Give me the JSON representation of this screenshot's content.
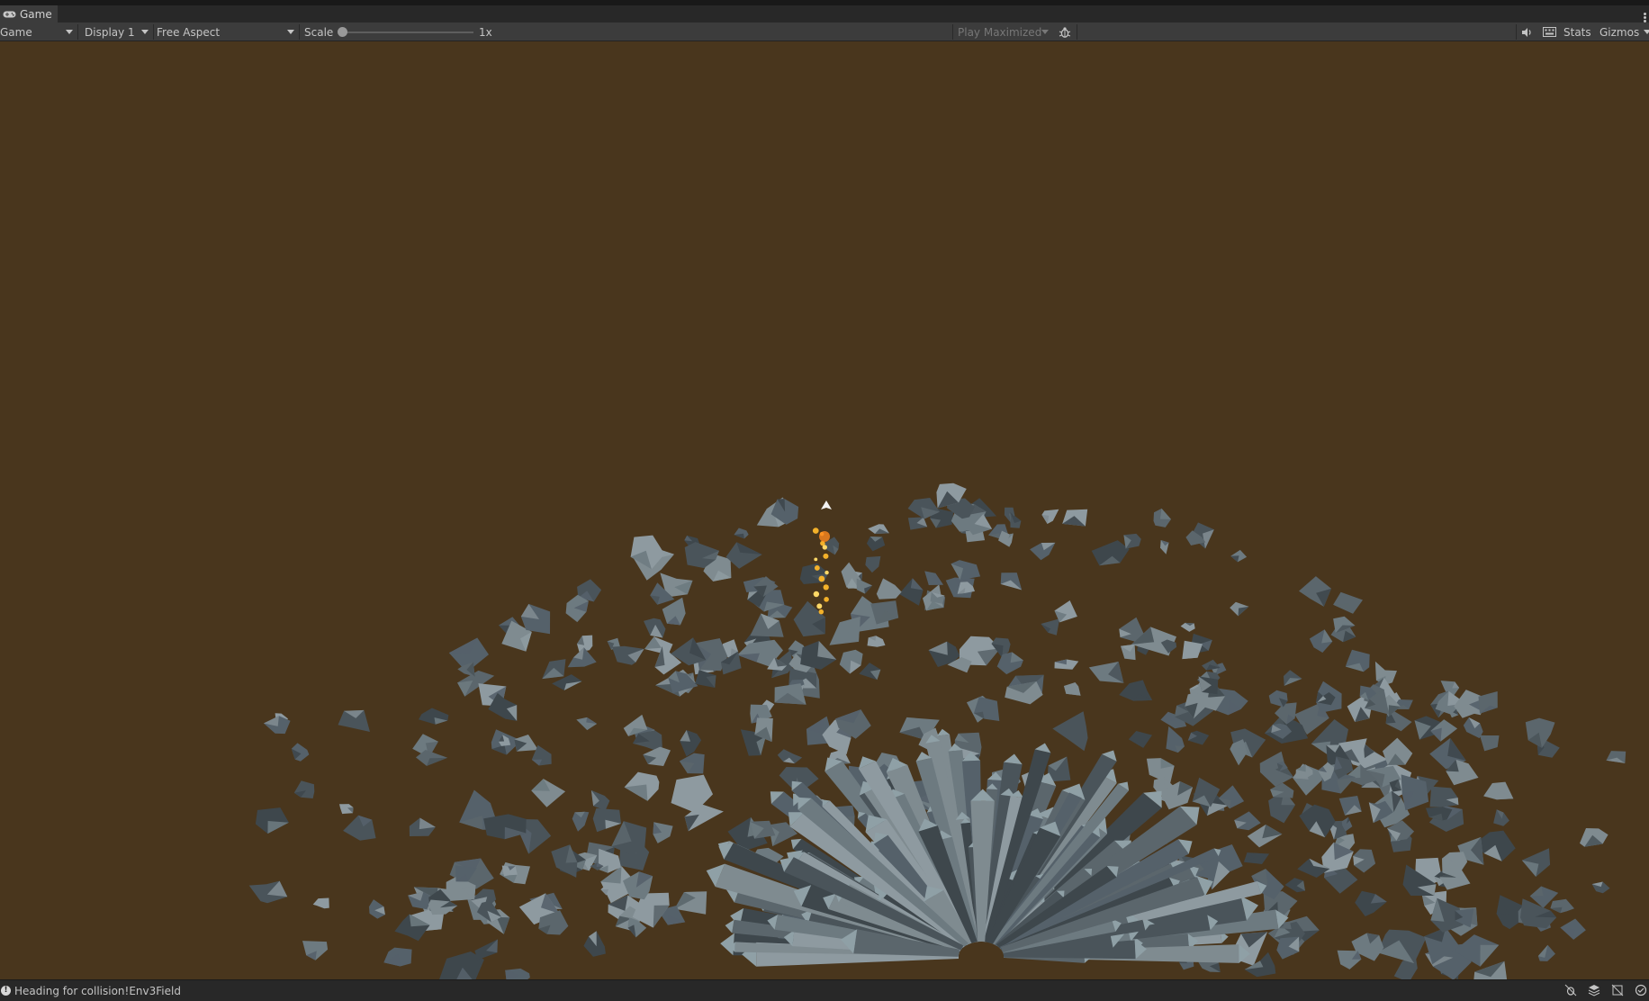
{
  "window": {
    "tab_title": "Game",
    "tab_icon": "gamepad-icon"
  },
  "toolbar": {
    "view_mode": "Game",
    "display": "Display 1",
    "aspect": "Free Aspect",
    "scale_label": "Scale",
    "scale_value": "1x",
    "scale_level": 0,
    "play_mode": "Play Maximized",
    "stats_label": "Stats",
    "gizmos_label": "Gizmos"
  },
  "scene": {
    "background_color": "#49361d",
    "debris_color": "#5b666c"
  },
  "status": {
    "message": "Heading for collision!Env3Field"
  }
}
